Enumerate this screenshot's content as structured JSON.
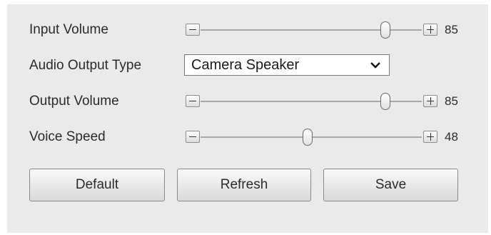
{
  "settings": {
    "input_volume": {
      "label": "Input Volume",
      "value": "85",
      "level": 0.85
    },
    "audio_output_type": {
      "label": "Audio Output Type",
      "selected": "Camera Speaker"
    },
    "output_volume": {
      "label": "Output Volume",
      "value": "85",
      "level": 0.85
    },
    "voice_speed": {
      "label": "Voice Speed",
      "value": "48",
      "level": 0.48
    }
  },
  "buttons": {
    "default_label": "Default",
    "refresh_label": "Refresh",
    "save_label": "Save"
  },
  "icons": {
    "decrease": "minus-icon",
    "increase": "plus-icon",
    "dropdown": "chevron-down-icon"
  }
}
